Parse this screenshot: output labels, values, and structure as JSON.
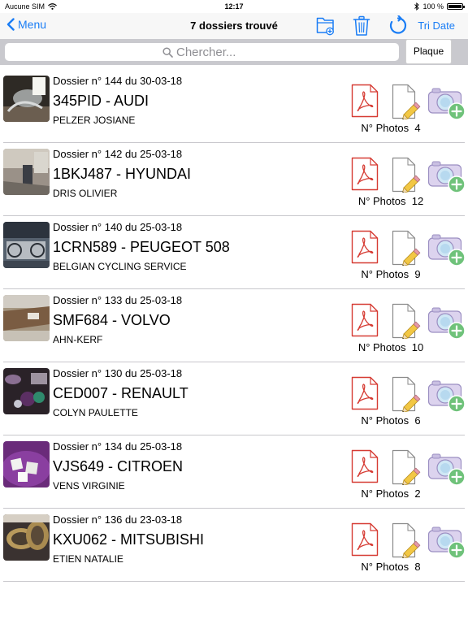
{
  "status_bar": {
    "carrier": "Aucune SIM",
    "time": "12:17",
    "battery": "100 %"
  },
  "nav": {
    "back_label": "Menu",
    "title": "7 dossiers trouvé",
    "sort_label": "Tri Date",
    "accent_color": "#1a7df5"
  },
  "search": {
    "placeholder": "Chercher...",
    "scope_label": "Plaque"
  },
  "photos_label": "N° Photos",
  "dossiers": [
    {
      "dossier": "Dossier n° 144 du 30-03-18",
      "title": "345PID - AUDI",
      "owner": "PELZER  JOSIANE",
      "photos": "4",
      "thumb": "glass"
    },
    {
      "dossier": "Dossier n° 142 du 25-03-18",
      "title": "1BKJ487 - HYUNDAI",
      "owner": "DRIS OLIVIER",
      "photos": "12",
      "thumb": "office"
    },
    {
      "dossier": "Dossier n° 140 du 25-03-18",
      "title": "1CRN589 - PEUGEOT 508",
      "owner": "BELGIAN CYCLING SERVICE",
      "photos": "9",
      "thumb": "bike"
    },
    {
      "dossier": "Dossier n° 133 du 25-03-18",
      "title": "SMF684 - VOLVO",
      "owner": "AHN-KERF",
      "photos": "10",
      "thumb": "table"
    },
    {
      "dossier": "Dossier n° 130 du 25-03-18",
      "title": "CED007 - RENAULT",
      "owner": "COLYN  PAULETTE",
      "photos": "6",
      "thumb": "toys"
    },
    {
      "dossier": "Dossier n° 134 du 25-03-18",
      "title": "VJS649 - CITROEN",
      "owner": "VENS  VIRGINIE",
      "photos": "2",
      "thumb": "bowl"
    },
    {
      "dossier": "Dossier n° 136 du 23-03-18",
      "title": "KXU062 - MITSUBISHI",
      "owner": "ETIEN NATALIE",
      "photos": "8",
      "thumb": "rings"
    }
  ]
}
